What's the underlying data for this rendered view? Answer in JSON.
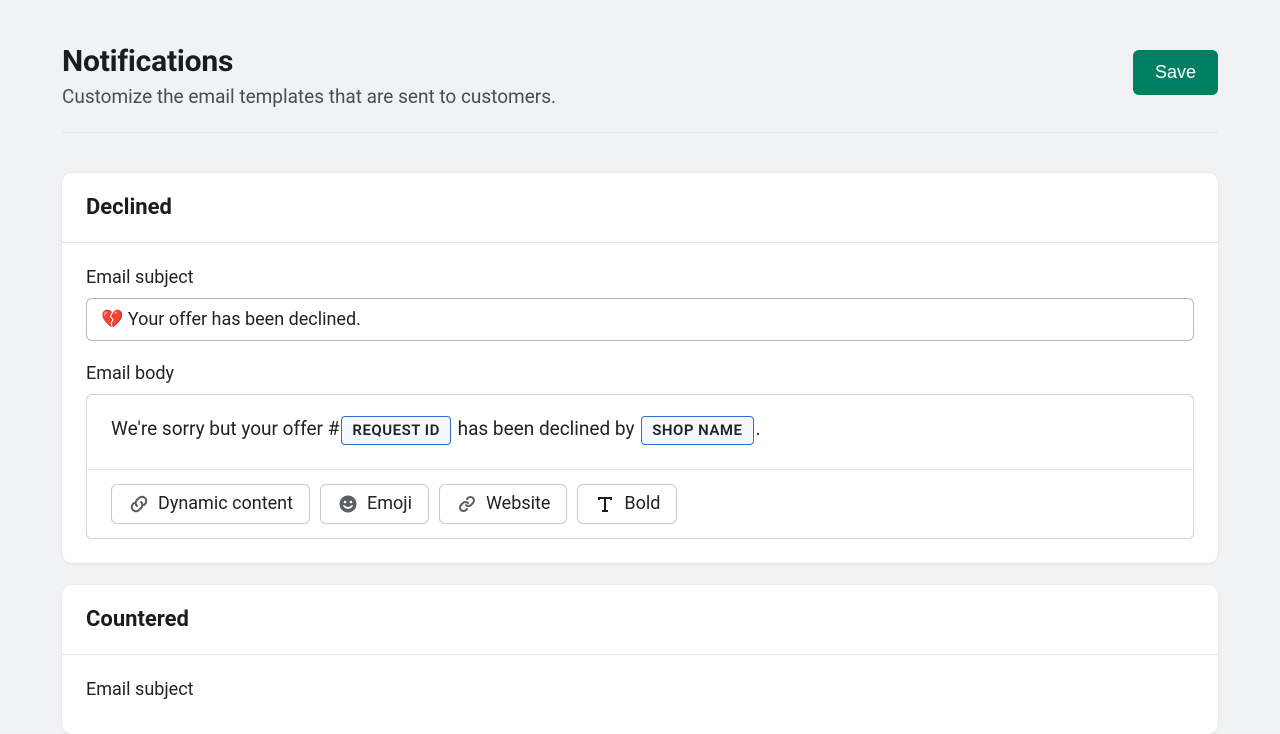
{
  "header": {
    "title": "Notifications",
    "subtitle": "Customize the email templates that are sent to customers.",
    "saveLabel": "Save"
  },
  "cards": [
    {
      "title": "Declined",
      "subjectLabel": "Email subject",
      "subjectValue": "💔 Your offer has been declined.",
      "bodyLabel": "Email body",
      "body": {
        "before": "We're sorry but your offer #",
        "token1": "REQUEST ID",
        "middle": " has been declined by ",
        "token2": "SHOP NAME",
        "after": "."
      },
      "toolbar": {
        "dynamic": "Dynamic content",
        "emoji": "Emoji",
        "website": "Website",
        "bold": "Bold"
      }
    },
    {
      "title": "Countered",
      "subjectLabel": "Email subject"
    }
  ]
}
